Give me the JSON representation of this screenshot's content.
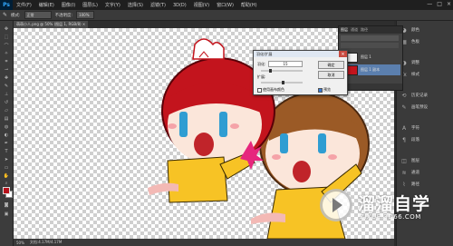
{
  "app": {
    "logo": "Ps"
  },
  "menu": {
    "items": [
      "文件(F)",
      "编辑(E)",
      "图像(I)",
      "图层(L)",
      "文字(Y)",
      "选择(S)",
      "滤镜(T)",
      "3D(D)",
      "视图(V)",
      "窗口(W)",
      "帮助(H)"
    ]
  },
  "window_controls": {
    "minimize": "—",
    "maximize": "□",
    "close": "×"
  },
  "options_bar": {
    "tool_icon": "brush-icon",
    "mode_label": "模式:",
    "mode_value": "正常",
    "opacity_label": "不透明度:",
    "opacity_value": "100%"
  },
  "document_tab": {
    "label": "萌萌小人.png @ 50% (图层 1, RGB/8) ×"
  },
  "status_bar": {
    "zoom": "50%",
    "doc_info": "文档:4.17M/4.17M"
  },
  "dialog": {
    "title": "羽化/扩展",
    "close": "×",
    "feather_label": "羽化:",
    "feather_value": "15",
    "expand_label": "扩展:",
    "ok_label": "确定",
    "cancel_label": "取消",
    "check1_label": "使用画布颜色",
    "check2_label": "预览"
  },
  "layers_panel": {
    "tabs": [
      "图层",
      "通道",
      "路径"
    ],
    "rows": [
      {
        "name": "图层 1",
        "active": false
      },
      {
        "name": "图层 1 副本",
        "active": true
      }
    ]
  },
  "dock": {
    "items": [
      {
        "icon": "color-icon",
        "label": "颜色"
      },
      {
        "icon": "swatches-icon",
        "label": "色板"
      },
      {
        "icon": "adjust-icon",
        "label": "调整"
      },
      {
        "icon": "style-icon",
        "label": "样式"
      },
      {
        "icon": "history-icon",
        "label": "历史记录"
      },
      {
        "icon": "brush-preset-icon",
        "label": "画笔预设"
      },
      {
        "icon": "char-icon",
        "label": "字符"
      },
      {
        "icon": "paragraph-icon",
        "label": "段落"
      },
      {
        "icon": "layers-icon",
        "label": "图层"
      },
      {
        "icon": "channels-icon",
        "label": "通道"
      },
      {
        "icon": "paths-icon",
        "label": "路径"
      }
    ]
  },
  "colors": {
    "foreground": "#b5121b",
    "background": "#ffffff",
    "accent": "#31a8ff"
  },
  "watermark": {
    "title": "溜溜自学",
    "url": "ZIXUE.3D66.COM"
  }
}
